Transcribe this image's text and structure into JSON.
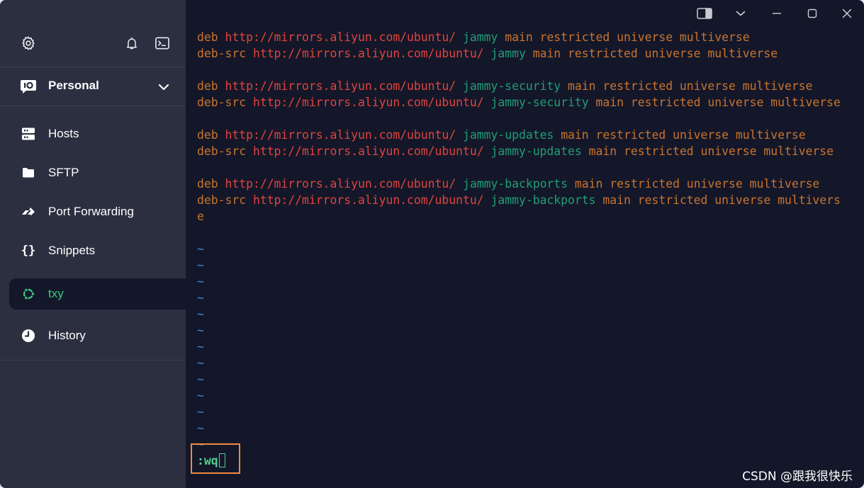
{
  "sidebar": {
    "vault": {
      "label": "Personal"
    },
    "nav": [
      {
        "label": "Hosts"
      },
      {
        "label": "SFTP"
      },
      {
        "label": "Port Forwarding"
      },
      {
        "label": "Snippets"
      },
      {
        "label": "txy"
      },
      {
        "label": "History"
      }
    ]
  },
  "terminal": {
    "lines": [
      {
        "kw": "deb",
        "url": "http://mirrors.aliyun.com/ubuntu/",
        "suite": "jammy",
        "components": "main restricted universe multiverse"
      },
      {
        "kw": "deb-src",
        "url": "http://mirrors.aliyun.com/ubuntu/",
        "suite": "jammy",
        "components": "main restricted universe multiverse"
      },
      {
        "kw": "deb",
        "url": "http://mirrors.aliyun.com/ubuntu/",
        "suite": "jammy-security",
        "components": "main restricted universe multiverse"
      },
      {
        "kw": "deb-src",
        "url": "http://mirrors.aliyun.com/ubuntu/",
        "suite": "jammy-security",
        "components": "main restricted universe multiverse"
      },
      {
        "kw": "deb",
        "url": "http://mirrors.aliyun.com/ubuntu/",
        "suite": "jammy-updates",
        "components": "main restricted universe multiverse"
      },
      {
        "kw": "deb-src",
        "url": "http://mirrors.aliyun.com/ubuntu/",
        "suite": "jammy-updates",
        "components": "main restricted universe multiverse"
      },
      {
        "kw": "deb",
        "url": "http://mirrors.aliyun.com/ubuntu/",
        "suite": "jammy-backports",
        "components": "main restricted universe multiverse"
      },
      {
        "kw": "deb-src",
        "url": "http://mirrors.aliyun.com/ubuntu/",
        "suite": "jammy-backports",
        "components": "main restricted universe multivers"
      }
    ],
    "wrap_continuation": "e",
    "tilde": "~",
    "command": ":wq"
  },
  "watermark": "CSDN @跟我很快乐",
  "colors": {
    "sidebar_bg": "#2b2f40",
    "terminal_bg": "#141729",
    "accent_green": "#3ec97e",
    "keyword_orange": "#c9742f",
    "url_red": "#e0443f",
    "suite_teal": "#1f9e78",
    "tilde_blue": "#4a86c8",
    "highlight_orange": "#f08a3c"
  },
  "icons": {
    "settings": "gear-icon",
    "notifications": "bell-icon",
    "local_terminal": "terminal-icon",
    "vault": "vault-icon",
    "vault_toggle": "chevron-down-icon",
    "hosts": "server-icon",
    "sftp": "folder-icon",
    "port_forwarding": "arrow-forward-icon",
    "snippets": "braces-icon",
    "session": "ubuntu-icon",
    "history": "clock-icon",
    "split_view": "split-panel-icon",
    "dropdown": "chevron-down-icon",
    "minimize": "minimize-icon",
    "maximize": "maximize-icon",
    "close": "close-icon"
  }
}
